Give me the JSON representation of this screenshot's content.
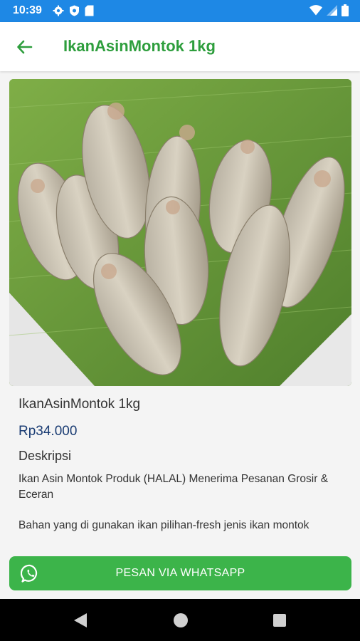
{
  "status_bar": {
    "time": "10:39",
    "left_icons": [
      "gear-icon",
      "shield-icon",
      "sd-card-icon"
    ],
    "right_icons": [
      "wifi-icon",
      "signal-icon",
      "battery-icon"
    ],
    "color": "#1e88e5"
  },
  "app_bar": {
    "title": "IkanAsinMontok 1kg",
    "back_icon": "arrow-left-icon",
    "accent": "#2e9e3d"
  },
  "product": {
    "name": "IkanAsinMontok 1kg",
    "price": "Rp34.000",
    "description_heading": "Deskripsi",
    "description_paragraphs": [
      "Ikan Asin Montok Produk (HALAL) Menerima Pesanan Grosir & Eceran",
      "Bahan yang di gunakan ikan pilihan-fresh jenis ikan montok"
    ],
    "price_color": "#1a3c73"
  },
  "order_button": {
    "label": "PESAN VIA WHATSAPP",
    "icon": "whatsapp-icon",
    "color": "#3cb44a"
  },
  "nav_bar": {
    "buttons": [
      "back-triangle-icon",
      "home-circle-icon",
      "recents-square-icon"
    ]
  }
}
